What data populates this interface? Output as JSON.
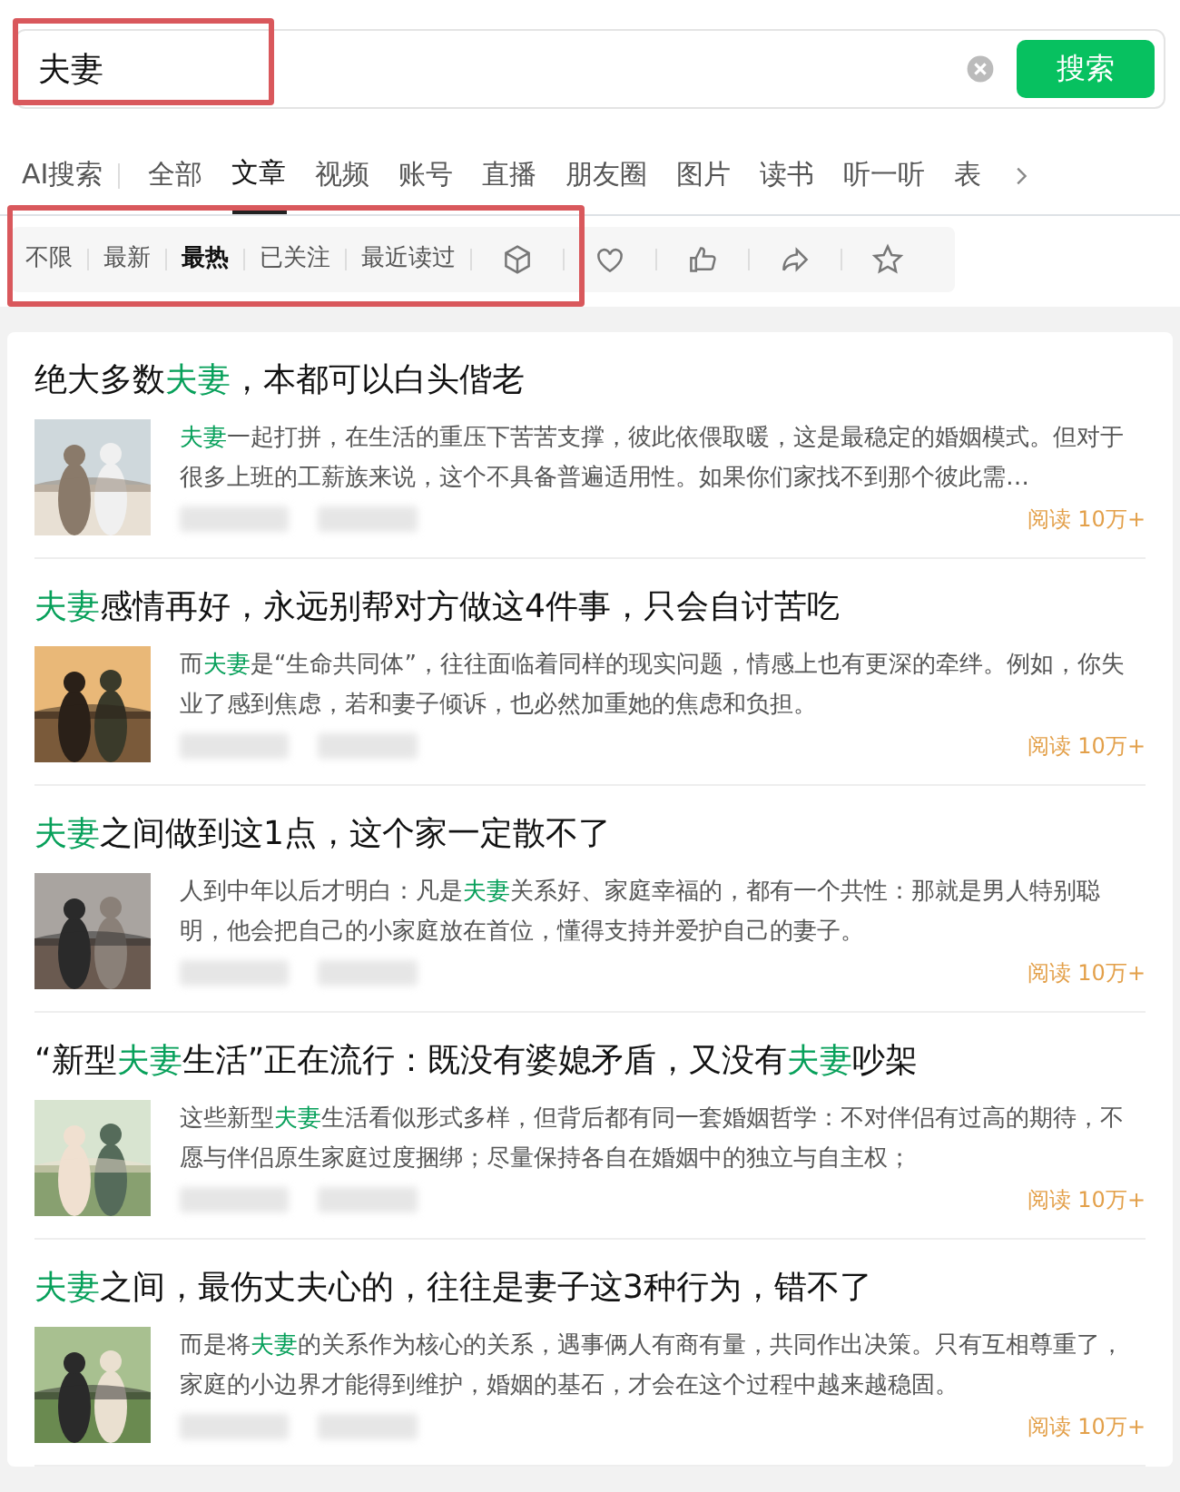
{
  "search": {
    "value": "夫妻",
    "highlighted": true,
    "button": "搜索"
  },
  "tabs": [
    {
      "label": "AI搜索",
      "selected": false
    },
    {
      "label": "全部",
      "selected": false
    },
    {
      "label": "文章",
      "selected": true
    },
    {
      "label": "视频",
      "selected": false
    },
    {
      "label": "账号",
      "selected": false
    },
    {
      "label": "直播",
      "selected": false
    },
    {
      "label": "朋友圈",
      "selected": false
    },
    {
      "label": "图片",
      "selected": false
    },
    {
      "label": "读书",
      "selected": false
    },
    {
      "label": "听一听",
      "selected": false
    },
    {
      "label": "表",
      "selected": false
    }
  ],
  "filters": {
    "highlighted": true,
    "items": [
      {
        "label": "不限",
        "selected": false
      },
      {
        "label": "最新",
        "selected": false
      },
      {
        "label": "最热",
        "selected": true
      },
      {
        "label": "已关注",
        "selected": false
      },
      {
        "label": "最近读过",
        "selected": false
      }
    ]
  },
  "articles": [
    {
      "title": [
        {
          "text": "绝大多数",
          "hit": false
        },
        {
          "text": "夫妻",
          "hit": true
        },
        {
          "text": "，本都可以白头偕老",
          "hit": false
        }
      ],
      "summary": [
        {
          "text": "夫妻",
          "hit": true
        },
        {
          "text": "一起打拼，在生活的重压下苦苦支撑，彼此依偎取暖，这是最稳定的婚姻模式。但对于很多上班的工薪族来说，这个不具备普遍适用性。如果你们家找不到那个彼此需…",
          "hit": false
        }
      ],
      "reads": "阅读 10万+"
    },
    {
      "title": [
        {
          "text": "夫妻",
          "hit": true
        },
        {
          "text": "感情再好，永远别帮对方做这4件事，只会自讨苦吃",
          "hit": false
        }
      ],
      "summary": [
        {
          "text": "而",
          "hit": false
        },
        {
          "text": "夫妻",
          "hit": true
        },
        {
          "text": "是“生命共同体”，往往面临着同样的现实问题，情感上也有更深的牵绊。例如，你失业了感到焦虑，若和妻子倾诉，也必然加重她的焦虑和负担。",
          "hit": false
        }
      ],
      "reads": "阅读 10万+"
    },
    {
      "title": [
        {
          "text": "夫妻",
          "hit": true
        },
        {
          "text": "之间做到这1点，这个家一定散不了",
          "hit": false
        }
      ],
      "summary": [
        {
          "text": "人到中年以后才明白：凡是",
          "hit": false
        },
        {
          "text": "夫妻",
          "hit": true
        },
        {
          "text": "关系好、家庭幸福的，都有一个共性：那就是男人特别聪明，他会把自己的小家庭放在首位，懂得支持并爱护自己的妻子。",
          "hit": false
        }
      ],
      "reads": "阅读 10万+"
    },
    {
      "title": [
        {
          "text": "“新型",
          "hit": false
        },
        {
          "text": "夫妻",
          "hit": true
        },
        {
          "text": "生活”正在流行：既没有婆媳矛盾，又没有",
          "hit": false
        },
        {
          "text": "夫妻",
          "hit": true
        },
        {
          "text": "吵架",
          "hit": false
        }
      ],
      "summary": [
        {
          "text": "这些新型",
          "hit": false
        },
        {
          "text": "夫妻",
          "hit": true
        },
        {
          "text": "生活看似形式多样，但背后都有同一套婚姻哲学：不对伴侣有过高的期待，不愿与伴侣原生家庭过度捆绑；尽量保持各自在婚姻中的独立与自主权；",
          "hit": false
        }
      ],
      "reads": "阅读 10万+"
    },
    {
      "title": [
        {
          "text": "夫妻",
          "hit": true
        },
        {
          "text": "之间，最伤丈夫心的，往往是妻子这3种行为，错不了",
          "hit": false
        }
      ],
      "summary": [
        {
          "text": "而是将",
          "hit": false
        },
        {
          "text": "夫妻",
          "hit": true
        },
        {
          "text": "的关系作为核心的关系，遇事俩人有商有量，共同作出决策。只有互相尊重了，家庭的小边界才能得到维护，婚姻的基石，才会在这个过程中越来越稳固。",
          "hit": false
        }
      ],
      "reads": "阅读 10万+"
    }
  ]
}
